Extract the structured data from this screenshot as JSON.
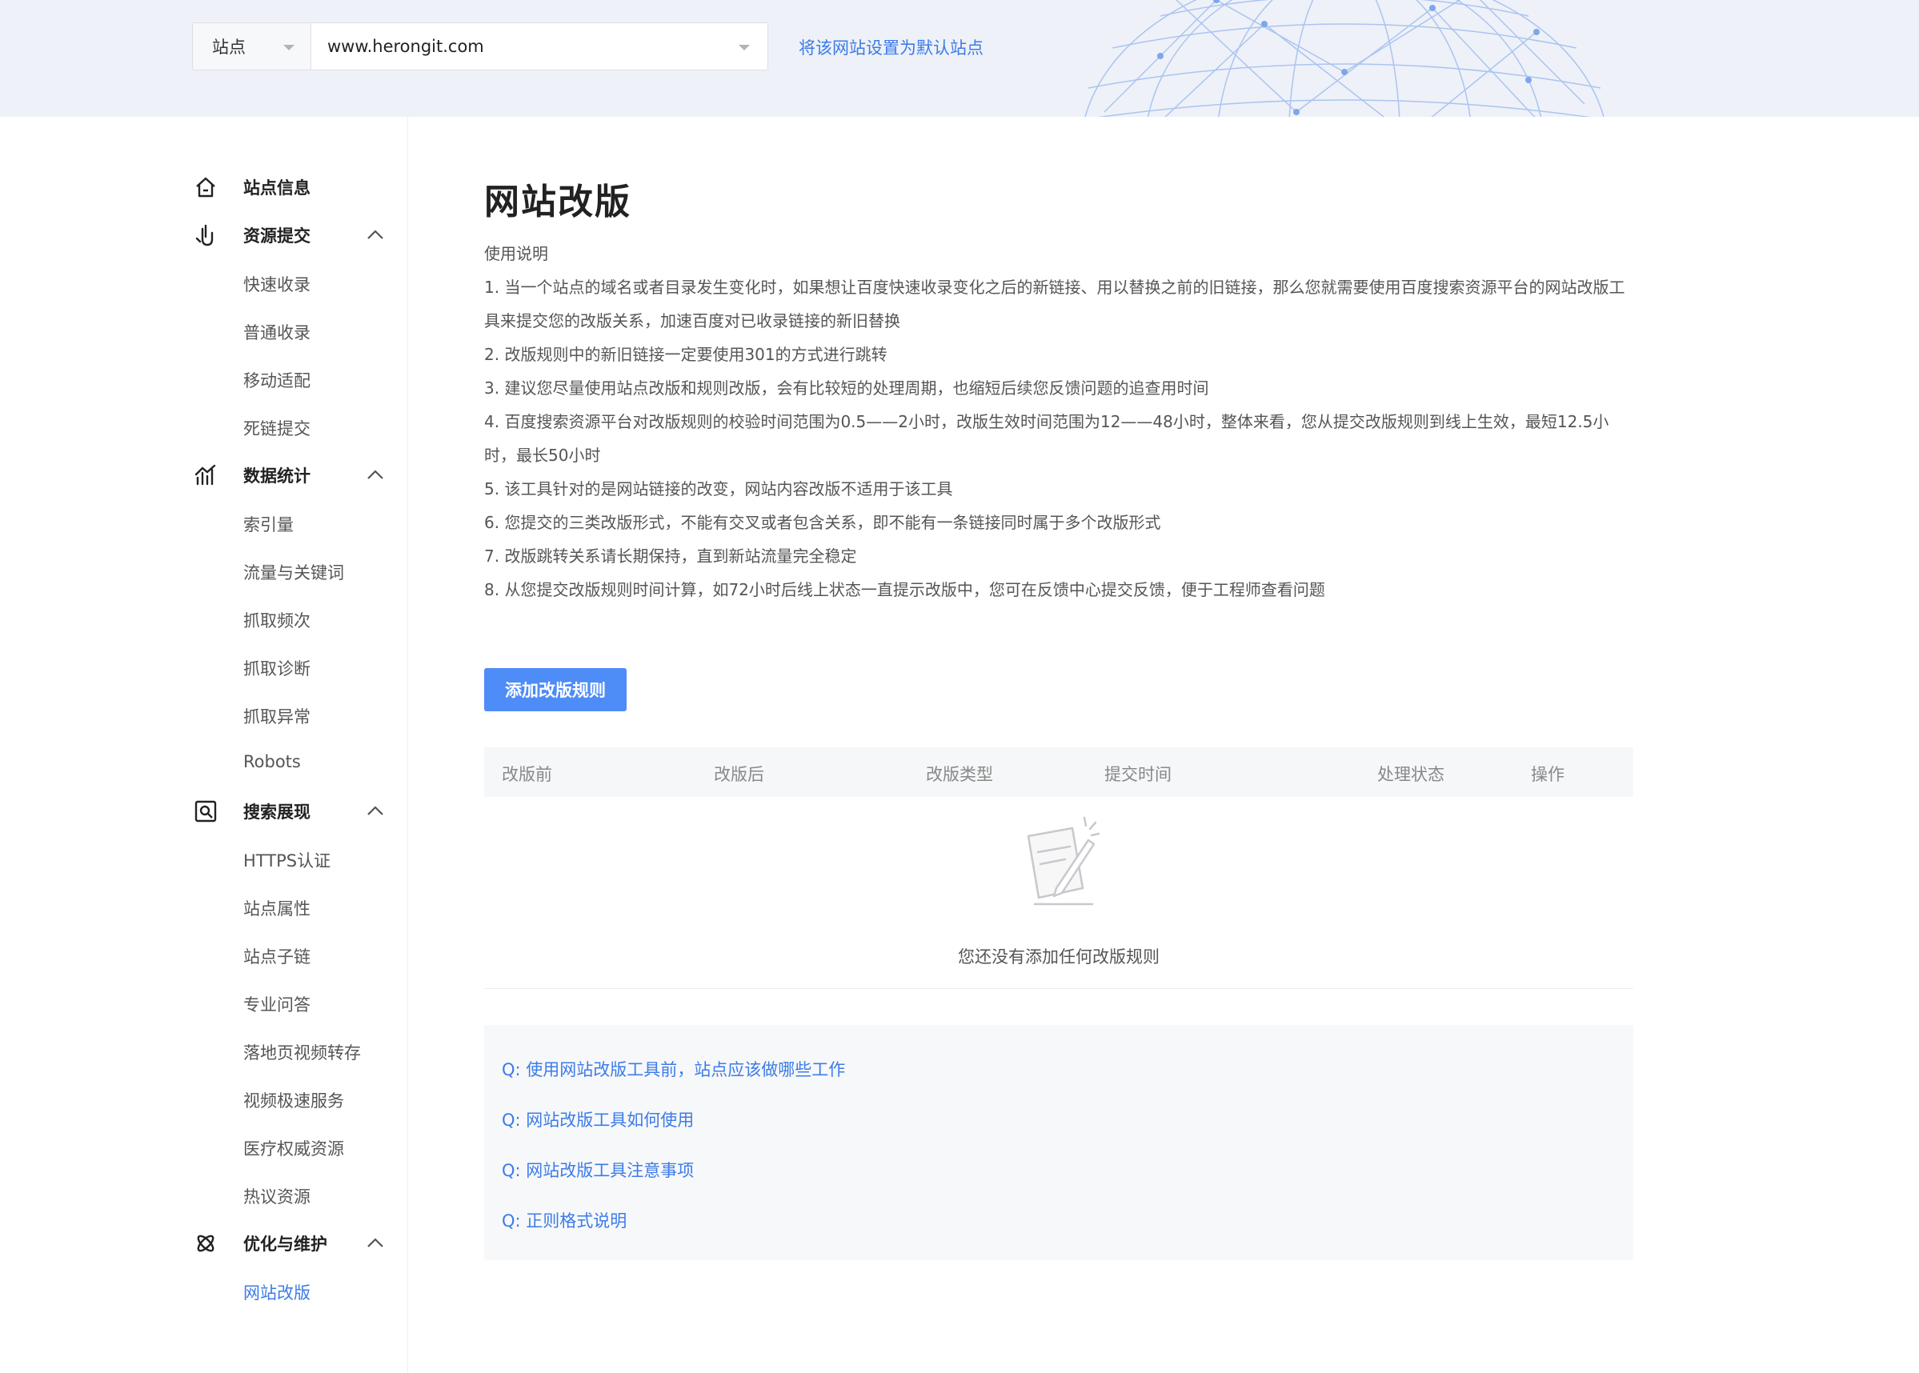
{
  "header": {
    "site_type": "站点",
    "site_url": "www.herongit.com",
    "set_default_link": "将该网站设置为默认站点"
  },
  "sidebar": {
    "groups": [
      {
        "label": "站点信息",
        "icon": "home-icon",
        "items": []
      },
      {
        "label": "资源提交",
        "icon": "submit-icon",
        "expanded": true,
        "items": [
          "快速收录",
          "普通收录",
          "移动适配",
          "死链提交"
        ]
      },
      {
        "label": "数据统计",
        "icon": "chart-icon",
        "expanded": true,
        "items": [
          "索引量",
          "流量与关键词",
          "抓取频次",
          "抓取诊断",
          "抓取异常",
          "Robots"
        ]
      },
      {
        "label": "搜索展现",
        "icon": "search-display-icon",
        "expanded": true,
        "items": [
          "HTTPS认证",
          "站点属性",
          "站点子链",
          "专业问答",
          "落地页视频转存",
          "视频极速服务",
          "医疗权威资源",
          "热议资源"
        ]
      },
      {
        "label": "优化与维护",
        "icon": "optimize-icon",
        "expanded": true,
        "items": [
          "网站改版"
        ]
      }
    ],
    "active_item": "网站改版",
    "accent_color": "#3c7be8"
  },
  "main": {
    "title": "网站改版",
    "instructions": [
      "使用说明",
      "1. 当一个站点的域名或者目录发生变化时，如果想让百度快速收录变化之后的新链接、用以替换之前的旧链接，那么您就需要使用百度搜索资源平台的网站改版工具来提交您的改版关系，加速百度对已收录链接的新旧替换",
      "2. 改版规则中的新旧链接一定要使用301的方式进行跳转",
      "3. 建议您尽量使用站点改版和规则改版，会有比较短的处理周期，也缩短后续您反馈问题的追查用时间",
      "4. 百度搜索资源平台对改版规则的校验时间范围为0.5——2小时，改版生效时间范围为12——48小时，整体来看，您从提交改版规则到线上生效，最短12.5小时，最长50小时",
      "5. 该工具针对的是网站链接的改变，网站内容改版不适用于该工具",
      "6. 您提交的三类改版形式，不能有交叉或者包含关系，即不能有一条链接同时属于多个改版形式",
      "7. 改版跳转关系请长期保持，直到新站流量完全稳定",
      "8. 从您提交改版规则时间计算，如72小时后线上状态一直提示改版中，您可在反馈中心提交反馈，便于工程师查看问题"
    ],
    "add_button": "添加改版规则",
    "button_color": "#4e8cf7",
    "table": {
      "columns": [
        "改版前",
        "改版后",
        "改版类型",
        "提交时间",
        "处理状态",
        "操作"
      ],
      "empty_text": "您还没有添加任何改版规则"
    },
    "faq": [
      "Q:  使用网站改版工具前，站点应该做哪些工作",
      "Q:  网站改版工具如何使用",
      "Q:  网站改版工具注意事项",
      "Q:  正则格式说明"
    ]
  }
}
